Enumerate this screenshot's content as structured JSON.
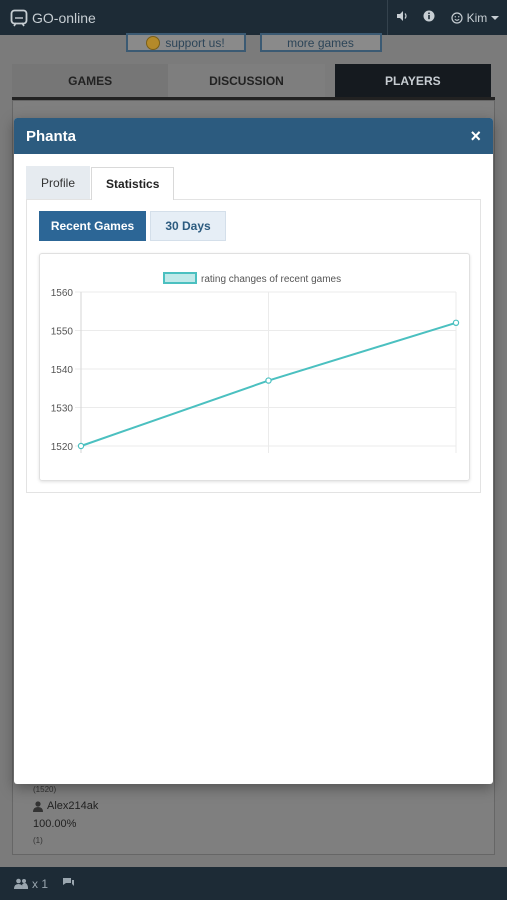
{
  "app": {
    "name": "GO-online",
    "user": "Kim",
    "icons": {
      "logo": "go-board-icon",
      "sound": "speaker-icon",
      "info": "info-icon",
      "user": "smiley-icon",
      "dropdown": "caret-down-icon"
    }
  },
  "promo": {
    "support_label": "support us!",
    "more_label": "more games"
  },
  "main_tabs": [
    {
      "label": "GAMES",
      "active": false
    },
    {
      "label": "DISCUSSION",
      "active": false
    },
    {
      "label": "PLAYERS",
      "active": true
    }
  ],
  "modal": {
    "title": "Phanta",
    "close_label": "×",
    "tabs": [
      {
        "label": "Profile",
        "active": false
      },
      {
        "label": "Statistics",
        "active": true
      }
    ],
    "subtabs": [
      {
        "label": "Recent Games",
        "active": true
      },
      {
        "label": "30 Days",
        "active": false
      }
    ]
  },
  "chart_data": {
    "type": "line",
    "legend": "rating changes of recent games",
    "legend_position": "top",
    "x": [
      1,
      2,
      3
    ],
    "series": [
      {
        "name": "rating changes of recent games",
        "values": [
          1520,
          1537,
          1552
        ],
        "color": "#4bc0c0"
      }
    ],
    "ylim": [
      1520,
      1560
    ],
    "yticks": [
      1520,
      1530,
      1540,
      1550,
      1560
    ],
    "grid": true
  },
  "background_list": {
    "rating_top": "(1520)",
    "player_name": "Alex214ak",
    "percent": "100.00%",
    "count": "(1)"
  },
  "bottom_bar": {
    "users_count": "x 1"
  }
}
